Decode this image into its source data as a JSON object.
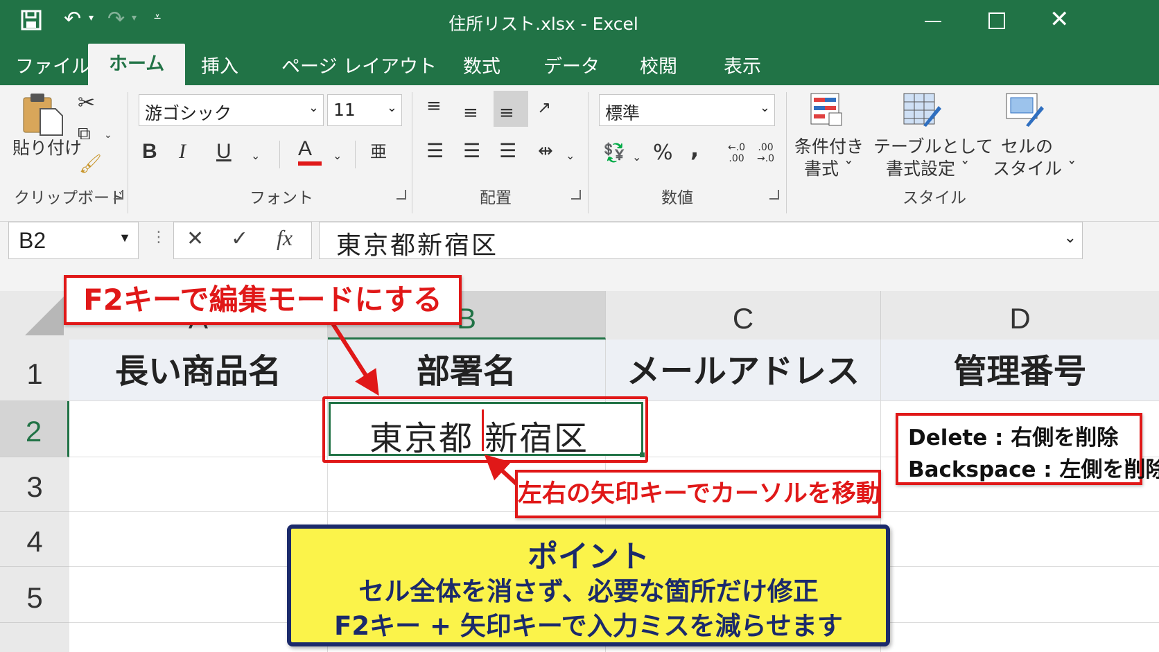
{
  "window": {
    "title": "住所リスト.xlsx  -  Excel"
  },
  "tabs": [
    "ファイル",
    "ホーム",
    "挿入",
    "ページ レイアウト",
    "数式",
    "データ",
    "校閲",
    "表示"
  ],
  "ribbon": {
    "clipboard": {
      "paste_label": "貼り付け",
      "group_label": "クリップボード"
    },
    "font": {
      "font_name": "游ゴシック",
      "font_size": "11",
      "bold": "B",
      "italic": "I",
      "underline": "U",
      "font_color_glyph": "A",
      "group_label": "フォント"
    },
    "alignment": {
      "group_label": "配置"
    },
    "number": {
      "format": "標準",
      "percent": "%",
      "comma": ",",
      "group_label": "数値"
    },
    "styles": {
      "conditional_line1": "条件付き",
      "conditional_line2": "書式 ˇ",
      "table_line1": "テーブルとして",
      "table_line2": "書式設定 ˇ",
      "cellstyle_line1": "セルの",
      "cellstyle_line2": "スタイル ˇ",
      "group_label": "スタイル"
    }
  },
  "formula_bar": {
    "name_box": "B2",
    "fx": "fx",
    "content": "東京都新宿区"
  },
  "sheet": {
    "columns": [
      "A",
      "B",
      "C",
      "D"
    ],
    "rows": [
      "1",
      "2",
      "3",
      "4",
      "5"
    ],
    "row1": [
      "長い商品名",
      "部署名",
      "メールアドレス",
      "管理番号"
    ],
    "b2_left": "東京都",
    "b2_right": "新宿区"
  },
  "annotations": {
    "f2_mode": "F2キーで編集モードにする",
    "arrow_keys": "左右の矢印キーでカーソルを移動",
    "delete_line": "Delete : 右側を削除",
    "backspace_line": "Backspace : 左側を削除",
    "point_title": "ポイント",
    "point_line1": "セル全体を消さず、必要な箇所だけ修正",
    "point_line2": "F2キー + 矢印キーで入力ミスを減らせます"
  },
  "colors": {
    "excel_green": "#217346",
    "callout_red": "#e01818",
    "point_yellow": "#fbf34a",
    "point_border": "#1b2a6b"
  }
}
